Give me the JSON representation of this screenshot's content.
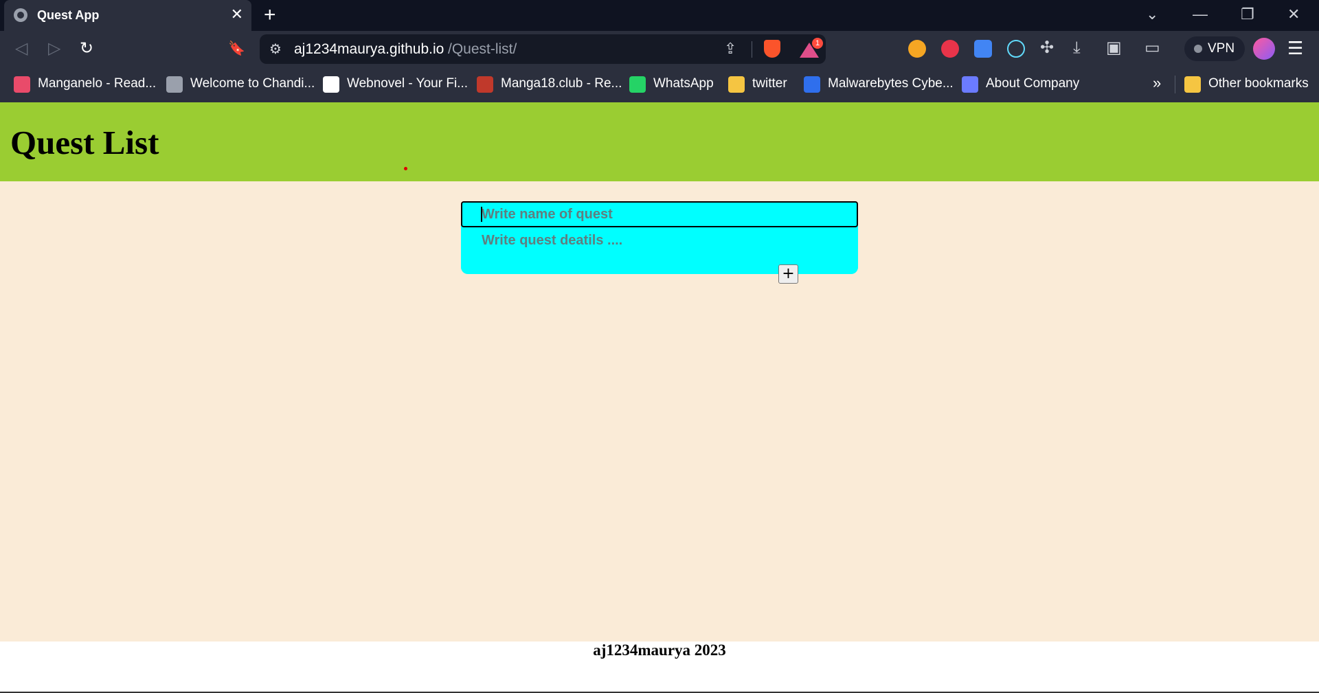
{
  "browser": {
    "tab": {
      "title": "Quest App",
      "close": "✕"
    },
    "new_tab": "+",
    "window_controls": {
      "dropdown": "⌄",
      "minimize": "—",
      "restore": "❐",
      "close": "✕"
    },
    "nav": {
      "back": "◁",
      "forward": "▷",
      "reload": "↻",
      "bookmark": "🔖"
    },
    "address": {
      "host": "aj1234maurya.github.io",
      "path": "/Quest-list/"
    },
    "rewards_badge": "1",
    "vpn_label": "VPN",
    "bookmarks": [
      {
        "label": "Manganelo - Read...",
        "icon": "manganelo-icon",
        "color": "#e94b6a"
      },
      {
        "label": "Welcome to Chandi...",
        "icon": "globe-icon",
        "color": "#9aa0ac"
      },
      {
        "label": "Webnovel - Your Fi...",
        "icon": "webnovel-icon",
        "color": "#ffffff"
      },
      {
        "label": "Manga18.club - Re...",
        "icon": "manga18-icon",
        "color": "#c0392b"
      },
      {
        "label": "WhatsApp",
        "icon": "whatsapp-icon",
        "color": "#25d366"
      },
      {
        "label": "twitter",
        "icon": "folder-icon",
        "color": "#f5c542"
      },
      {
        "label": "Malwarebytes Cybe...",
        "icon": "malwarebytes-icon",
        "color": "#2f6fed"
      },
      {
        "label": "About Company",
        "icon": "company-icon",
        "color": "#6b7bff"
      }
    ],
    "more_bookmarks": "»",
    "other_bookmarks": "Other bookmarks"
  },
  "app": {
    "title": "Quest List",
    "quest_name_placeholder": "Write name of quest",
    "quest_details_placeholder": "Write quest deatils ....",
    "add_label": "+",
    "footer": "aj1234maurya 2023"
  },
  "colors": {
    "header_bg": "#9acd32",
    "page_bg": "#faebd7",
    "card_bg": "#00ffff"
  }
}
